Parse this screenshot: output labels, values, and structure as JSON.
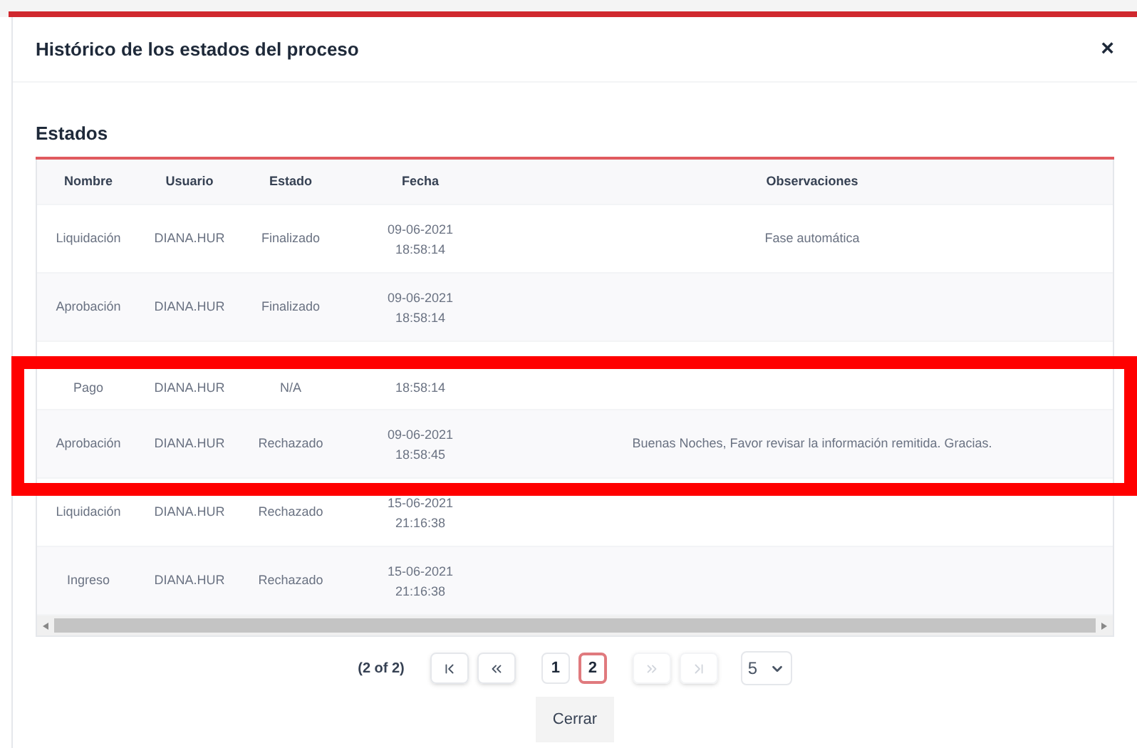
{
  "dialog": {
    "title": "Histórico de los estados del proceso",
    "close": "×"
  },
  "section": {
    "title": "Estados"
  },
  "table": {
    "columns": [
      "Nombre",
      "Usuario",
      "Estado",
      "Fecha",
      "Observaciones"
    ],
    "rows": [
      {
        "cells": [
          "Liquidación",
          "DIANA.HUR",
          "Finalizado",
          "09-06-2021 18:58:14",
          "Fase automática"
        ]
      },
      {
        "cells": [
          "Aprobación",
          "DIANA.HUR",
          "Finalizado",
          "09-06-2021 18:58:14",
          ""
        ]
      },
      {
        "cells": [
          "Pago",
          "DIANA.HUR",
          "N/A",
          "18:58:14",
          ""
        ]
      },
      {
        "cells": [
          "Aprobación",
          "DIANA.HUR",
          "Rechazado",
          "09-06-2021 18:58:45",
          "Buenas Noches, Favor revisar la información remitida. Gracias."
        ]
      },
      {
        "cells": [
          "Liquidación",
          "DIANA.HUR",
          "Rechazado",
          "15-06-2021 21:16:38",
          ""
        ]
      },
      {
        "cells": [
          "Ingreso",
          "DIANA.HUR",
          "Rechazado",
          "15-06-2021 21:16:38",
          ""
        ]
      }
    ]
  },
  "pagination": {
    "summary": "(2 of 2)",
    "first_disabled": false,
    "prev_disabled": false,
    "next_disabled": true,
    "last_disabled": true,
    "pages": [
      {
        "label": "1",
        "selected": false
      },
      {
        "label": "2",
        "selected": true
      }
    ],
    "rows_per_page": "5"
  },
  "buttons": [
    "Cerrar"
  ]
}
